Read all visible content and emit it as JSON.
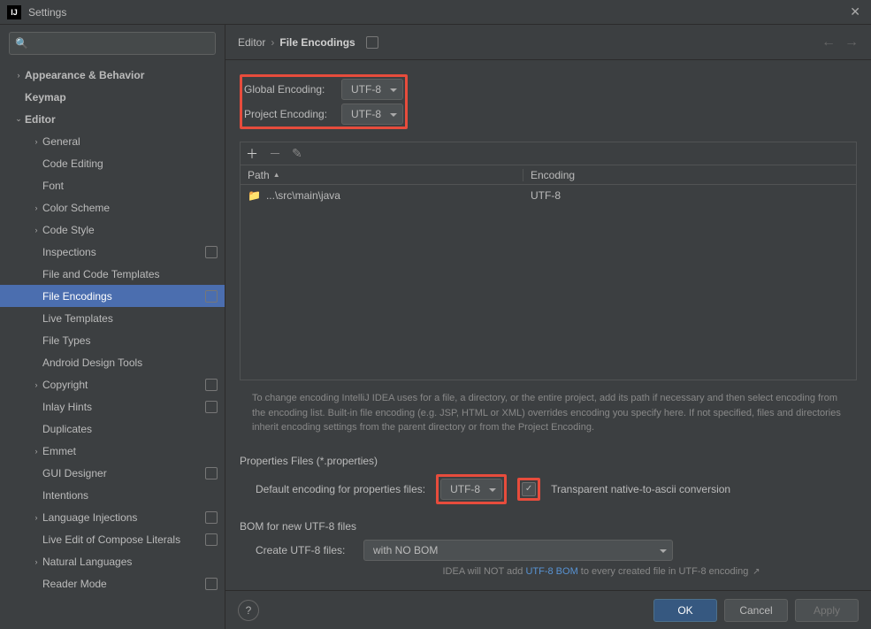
{
  "title": "Settings",
  "breadcrumb": {
    "parent": "Editor",
    "current": "File Encodings"
  },
  "sidebar": {
    "items": [
      {
        "label": "Appearance & Behavior",
        "indent": 0,
        "chevron": "right",
        "bold": true
      },
      {
        "label": "Keymap",
        "indent": 0,
        "chevron": "",
        "bold": true
      },
      {
        "label": "Editor",
        "indent": 0,
        "chevron": "down",
        "bold": true
      },
      {
        "label": "General",
        "indent": 1,
        "chevron": "right"
      },
      {
        "label": "Code Editing",
        "indent": 1,
        "chevron": ""
      },
      {
        "label": "Font",
        "indent": 1,
        "chevron": ""
      },
      {
        "label": "Color Scheme",
        "indent": 1,
        "chevron": "right"
      },
      {
        "label": "Code Style",
        "indent": 1,
        "chevron": "right"
      },
      {
        "label": "Inspections",
        "indent": 1,
        "chevron": "",
        "badge": true
      },
      {
        "label": "File and Code Templates",
        "indent": 1,
        "chevron": ""
      },
      {
        "label": "File Encodings",
        "indent": 1,
        "chevron": "",
        "badge": true,
        "selected": true
      },
      {
        "label": "Live Templates",
        "indent": 1,
        "chevron": ""
      },
      {
        "label": "File Types",
        "indent": 1,
        "chevron": ""
      },
      {
        "label": "Android Design Tools",
        "indent": 1,
        "chevron": ""
      },
      {
        "label": "Copyright",
        "indent": 1,
        "chevron": "right",
        "badge": true
      },
      {
        "label": "Inlay Hints",
        "indent": 1,
        "chevron": "",
        "badge": true
      },
      {
        "label": "Duplicates",
        "indent": 1,
        "chevron": ""
      },
      {
        "label": "Emmet",
        "indent": 1,
        "chevron": "right"
      },
      {
        "label": "GUI Designer",
        "indent": 1,
        "chevron": "",
        "badge": true
      },
      {
        "label": "Intentions",
        "indent": 1,
        "chevron": ""
      },
      {
        "label": "Language Injections",
        "indent": 1,
        "chevron": "right",
        "badge": true
      },
      {
        "label": "Live Edit of Compose Literals",
        "indent": 1,
        "chevron": "",
        "badge": true
      },
      {
        "label": "Natural Languages",
        "indent": 1,
        "chevron": "right"
      },
      {
        "label": "Reader Mode",
        "indent": 1,
        "chevron": "",
        "badge": true
      }
    ]
  },
  "form": {
    "global_encoding_label": "Global Encoding:",
    "global_encoding_value": "UTF-8",
    "project_encoding_label": "Project Encoding:",
    "project_encoding_value": "UTF-8"
  },
  "table": {
    "col_path": "Path",
    "col_encoding": "Encoding",
    "rows": [
      {
        "path": "...\\src\\main\\java",
        "encoding": "UTF-8"
      }
    ]
  },
  "help_text": "To change encoding IntelliJ IDEA uses for a file, a directory, or the entire project, add its path if necessary and then select encoding from the encoding list. Built-in file encoding (e.g. JSP, HTML or XML) overrides encoding you specify here. If not specified, files and directories inherit encoding settings from the parent directory or from the Project Encoding.",
  "props_section": {
    "title": "Properties Files (*.properties)",
    "default_label": "Default encoding for properties files:",
    "default_value": "UTF-8",
    "transparent_label": "Transparent native-to-ascii conversion",
    "transparent_checked": true
  },
  "bom_section": {
    "title": "BOM for new UTF-8 files",
    "create_label": "Create UTF-8 files:",
    "create_value": "with NO BOM",
    "note_prefix": "IDEA will NOT add ",
    "note_link": "UTF-8 BOM",
    "note_suffix": " to every created file in UTF-8 encoding"
  },
  "buttons": {
    "ok": "OK",
    "cancel": "Cancel",
    "apply": "Apply"
  }
}
